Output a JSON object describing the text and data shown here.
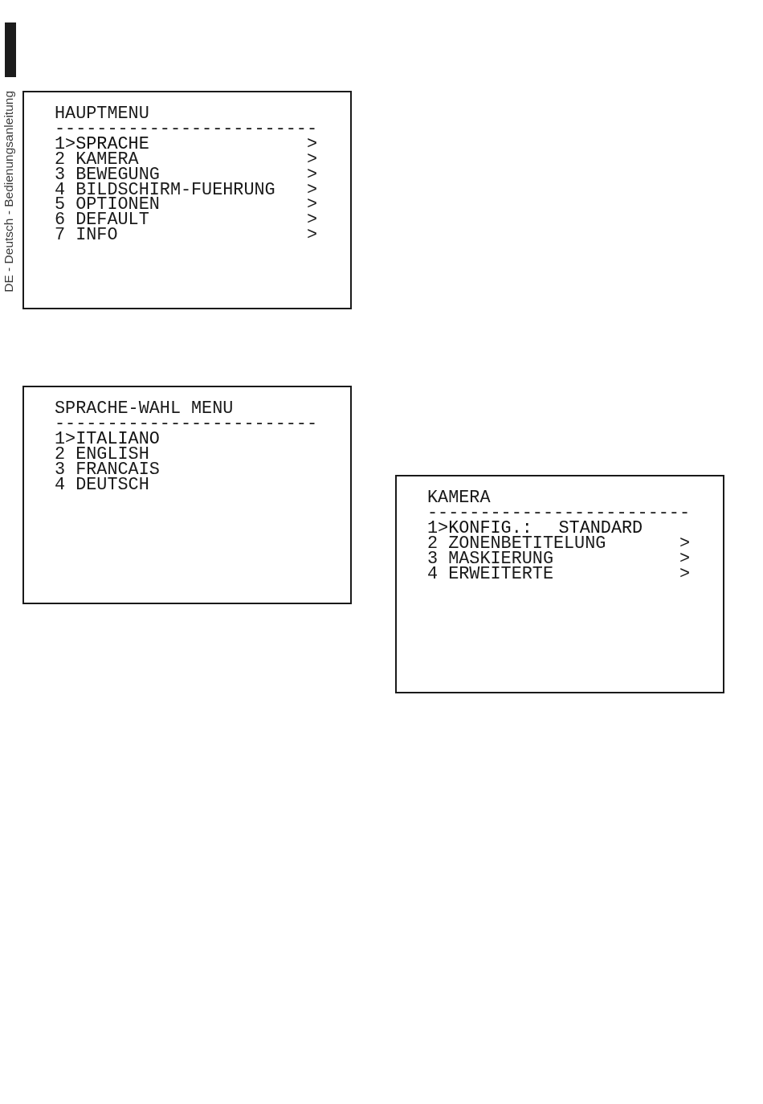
{
  "side_tab": {
    "label": "DE - Deutsch - Bedienungsanleitung"
  },
  "menus": [
    {
      "title": "HAUPTMENU",
      "separator": "-------------------------",
      "cursor": ">",
      "items": [
        {
          "number": "1",
          "label": "SPRACHE",
          "arrow": ">",
          "selected": true
        },
        {
          "number": "2",
          "label": "KAMERA",
          "arrow": ">",
          "selected": false
        },
        {
          "number": "3",
          "label": "BEWEGUNG",
          "arrow": ">",
          "selected": false
        },
        {
          "number": "4",
          "label": "BILDSCHIRM-FUEHRUNG",
          "arrow": ">",
          "selected": false
        },
        {
          "number": "5",
          "label": "OPTIONEN",
          "arrow": ">",
          "selected": false
        },
        {
          "number": "6",
          "label": "DEFAULT",
          "arrow": ">",
          "selected": false
        },
        {
          "number": "7",
          "label": "INFO",
          "arrow": ">",
          "selected": false
        }
      ]
    },
    {
      "title": "SPRACHE-WAHL MENU",
      "separator": "-------------------------",
      "cursor": ">",
      "items": [
        {
          "number": "1",
          "label": "ITALIANO",
          "selected": true
        },
        {
          "number": "2",
          "label": "ENGLISH",
          "selected": false
        },
        {
          "number": "3",
          "label": "FRANCAIS",
          "selected": false
        },
        {
          "number": "4",
          "label": "DEUTSCH",
          "selected": false
        }
      ]
    },
    {
      "title": "KAMERA",
      "separator": "-------------------------",
      "cursor": ">",
      "items": [
        {
          "number": "1",
          "label": "KONFIG.:",
          "value": "STANDARD",
          "selected": true
        },
        {
          "number": "2",
          "label": "ZONENBETITELUNG",
          "arrow": ">",
          "selected": false
        },
        {
          "number": "3",
          "label": "MASKIERUNG",
          "arrow": ">",
          "selected": false
        },
        {
          "number": "4",
          "label": "ERWEITERTE",
          "arrow": ">",
          "selected": false
        }
      ]
    }
  ]
}
